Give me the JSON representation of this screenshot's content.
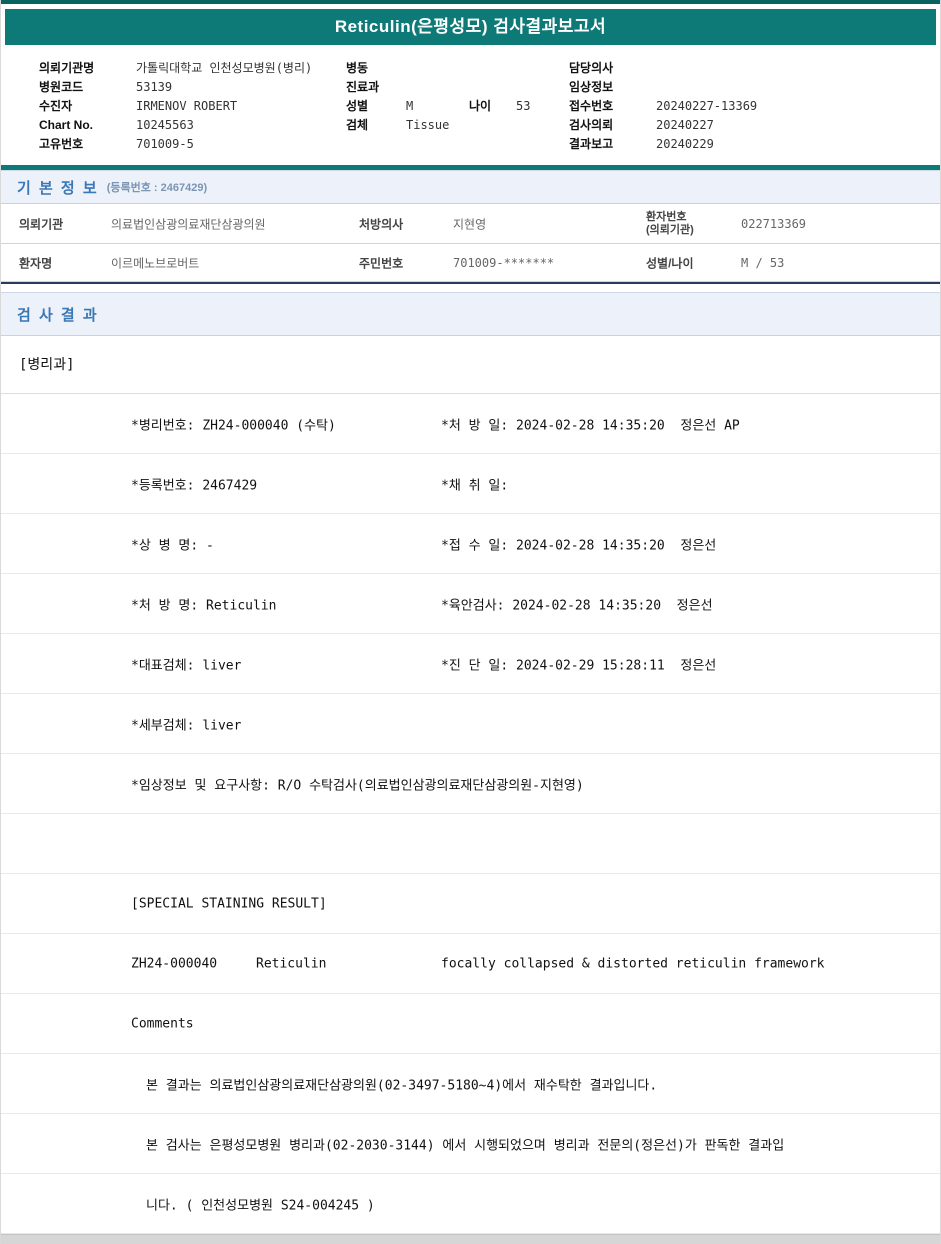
{
  "window": {
    "title": "Reticulin(은평성모) 검사결과보고서"
  },
  "header": {
    "col1": [
      {
        "label": "의뢰기관명",
        "value": "가톨릭대학교 인천성모병원(병리)"
      },
      {
        "label": "병원코드",
        "value": "53139"
      },
      {
        "label": "수진자",
        "value": "IRMENOV ROBERT"
      },
      {
        "label": "Chart No.",
        "value": "10245563"
      },
      {
        "label": "고유번호",
        "value": "701009-5"
      }
    ],
    "col2": [
      {
        "label": "병동",
        "value": ""
      },
      {
        "label": "진료과",
        "value": ""
      },
      {
        "label": "성별",
        "value": "M",
        "extra_label": "나이",
        "extra_value": "53"
      },
      {
        "label": "검체",
        "value": "Tissue"
      }
    ],
    "col3": [
      {
        "label": "담당의사",
        "value": ""
      },
      {
        "label": "임상정보",
        "value": ""
      },
      {
        "label": "접수번호",
        "value": "20240227-13369"
      },
      {
        "label": "검사의뢰",
        "value": "20240227"
      },
      {
        "label": "결과보고",
        "value": "20240229"
      }
    ]
  },
  "basic_info": {
    "title": "기 본 정 보",
    "reg_note": "(등록번호 : 2467429)",
    "row1": {
      "c1_label": "의뢰기관",
      "c1_value": "의료법인삼광의료재단삼광의원",
      "c2_label": "처방의사",
      "c2_value": "지현영",
      "c3_label_line1": "환자번호",
      "c3_label_line2": "(의뢰기관)",
      "c3_value": "022713369"
    },
    "row2": {
      "c1_label": "환자명",
      "c1_value": "이르메노브로버트",
      "c2_label": "주민번호",
      "c2_value": "701009-*******",
      "c3_label": "성별/나이",
      "c3_value": "M / 53"
    }
  },
  "results": {
    "title": "검 사 결 과",
    "department": "[병리과]",
    "detail_rows": [
      {
        "left": "*병리번호: ZH24-000040 (수탁)",
        "right": "*처 방 일: 2024-02-28 14:35:20  정은선 AP"
      },
      {
        "left": "*등록번호: 2467429",
        "right": "*채 취 일:"
      },
      {
        "left": "*상 병 명: -",
        "right": "*접 수 일: 2024-02-28 14:35:20  정은선"
      },
      {
        "left": "*처 방 명: Reticulin",
        "right": "*육안검사: 2024-02-28 14:35:20  정은선"
      },
      {
        "left": "*대표검체: liver",
        "right": "*진 단 일: 2024-02-29 15:28:11  정은선"
      },
      {
        "left": "*세부검체: liver",
        "right": ""
      }
    ],
    "clinical_info": "*임상정보 및 요구사항: R/O 수탁검사(의료법인삼광의료재단삼광의원-지현영)",
    "staining_header": "[SPECIAL STAINING RESULT]",
    "staining_row": {
      "specimen_no": "ZH24-000040",
      "stain": "Reticulin",
      "result": "focally collapsed & distorted reticulin framework"
    },
    "comments_label": "Comments",
    "comment_lines": [
      "본 결과는 의료법인삼광의료재단삼광의원(02-3497-5180~4)에서 재수탁한 결과입니다.",
      "본 검사는 은평성모병원 병리과(02-2030-3144) 에서 시행되었으며 병리과 전문의(정은선)가 판독한 결과입",
      "니다. ( 인천성모병원 S24-004245 )"
    ]
  },
  "colors": {
    "teal": "#0e7a78",
    "teal_dark": "#0a6361",
    "section_bg": "#edf2fa",
    "section_title_blue": "#3a77b5",
    "dark_rule_navy": "#2b3a5c"
  }
}
